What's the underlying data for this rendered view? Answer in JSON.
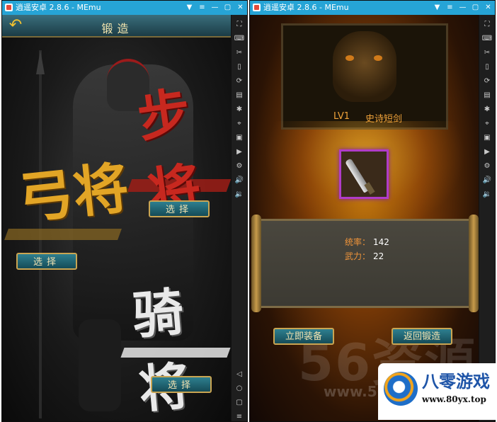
{
  "window1": {
    "title": "逍遥安卓 2.8.6 - MEmu",
    "controls": [
      "▼",
      "≡",
      "—",
      "▢",
      "✕"
    ],
    "header": "锻造",
    "calligraphy": {
      "bu": "步将",
      "gong": "弓将",
      "qi": "骑将"
    },
    "buttons": {
      "bu": "选择",
      "gong": "选择",
      "qi": "选择"
    }
  },
  "window2": {
    "title": "逍遥安卓 2.8.6 - MEmu",
    "controls": [
      "▼",
      "≡",
      "—",
      "▢",
      "✕"
    ],
    "item": {
      "level": "LV1",
      "name": "史诗短剑",
      "rarity_color": "#b03cc8"
    },
    "stats": [
      {
        "key": "统率：",
        "value": "142"
      },
      {
        "key": "武力：",
        "value": "22"
      }
    ],
    "buttons": {
      "equip": "立即装备",
      "back": "返回锻造"
    },
    "watermark": {
      "big": "56资源",
      "small": "www.56z"
    }
  },
  "sidebar_icons": [
    "fullscreen-icon",
    "keyboard-icon",
    "cut-icon",
    "shake-icon",
    "rotate-icon",
    "apk-icon",
    "screenshot-icon",
    "location-icon",
    "record-icon",
    "video-icon",
    "settings-icon",
    "volume-up-icon",
    "volume-down-icon"
  ],
  "nav_icons": [
    "back-icon",
    "home-icon",
    "recent-icon",
    "menu-icon"
  ],
  "badge": {
    "title": "八零游戏",
    "url": "www.80yx.top"
  },
  "colors": {
    "titlebar": "#26a4d6",
    "gold": "#caa552",
    "button": "#1f6472",
    "stat_key": "#f0943a"
  }
}
